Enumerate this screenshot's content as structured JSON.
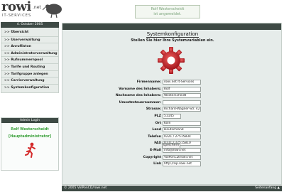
{
  "brand": {
    "name": "rowi",
    "tld": ".net",
    "tagline": "IT-SERVICES"
  },
  "login_banner": {
    "line1": "Rolf Westerscheidt",
    "line2": "ist angemeldet."
  },
  "sidebar": {
    "date": "4. October 2005",
    "items": [
      {
        "label": "Übersicht"
      },
      {
        "label": "Userverwaltung"
      },
      {
        "label": "Anrufliston"
      },
      {
        "label": "Administratorverwaltung"
      },
      {
        "label": "Rufnummernpool"
      },
      {
        "label": "Tarife und Routing"
      },
      {
        "label": "Tarifgruppe anlegen"
      },
      {
        "label": "Carrierverwaltung"
      },
      {
        "label": "Systemkonfiguration"
      }
    ],
    "arrow": ">>"
  },
  "admin": {
    "heading": "Admin Login",
    "name": "Rolf Westerscheidt",
    "role": "[Hauptadministrator]",
    "exit_icon": "running-man-exit-icon"
  },
  "main": {
    "title": "Systemkonfiguration",
    "subtitle": "Stellen Sie hier Ihre Systemvariablen ein.",
    "icon": "gear-icon",
    "fields": [
      {
        "label": "Firmenname:",
        "value": "rowi.net It-Services"
      },
      {
        "label": "Vorname des Inhabers:",
        "value": "Rolf"
      },
      {
        "label": "Nachname des Inhabers:",
        "value": "Westerscheidt"
      },
      {
        "label": "Umsatzsteuernummer:",
        "value": ""
      },
      {
        "label": "Strasse:",
        "value": "Richard-Wagner-Str. 42"
      },
      {
        "label": "PLZ",
        "value": "51145"
      },
      {
        "label": "Ort",
        "value": "Köln"
      },
      {
        "label": "Land",
        "value": "Deutschland"
      },
      {
        "label": "Telefon",
        "value": "0221 / 27515834"
      },
      {
        "label": "FAX",
        "value": "0221 / 27515810"
      },
      {
        "label": "E-Mail",
        "value": "info@rowi.net"
      },
      {
        "label": "Copyright",
        "value": "VoIPonCD/rowi.net"
      },
      {
        "label": "Link",
        "value": "http://sip.rowi.net"
      }
    ],
    "save_label": "speichern"
  },
  "footer": {
    "copyright": "© 2005 VoIPonCD/rowi.net",
    "top_link": "Seitenanfang ▲"
  },
  "colors": {
    "header_bar": "#3e4a45",
    "panel_bg": "#e6ecea",
    "accent_green": "#39a039",
    "gear_red": "#c0222a"
  }
}
